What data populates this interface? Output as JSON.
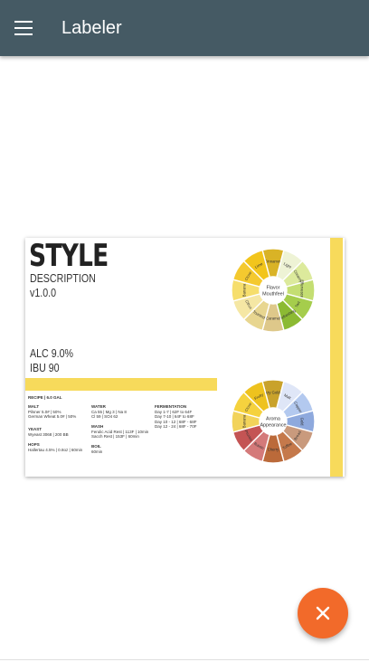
{
  "app": {
    "title": "Labeler"
  },
  "label": {
    "style": "STYLE",
    "description": "DESCRIPTION",
    "version": "v1.0.0",
    "abv": "ALC 9.0%",
    "ibu": "IBU 90",
    "recipe": {
      "heading": "RECIPE | 6.0 GAL",
      "malt_heading": "MALT",
      "malt": [
        "Pilsner 5.0# | 50%",
        "German Wheat 5.0# | 50%"
      ],
      "yeast_heading": "YEAST",
      "yeast": [
        "Wyeast 3068 | 200 BB"
      ],
      "hops_heading": "HOPS",
      "hops": [
        "Hallertau 4.5% | 0.8oz | 60min"
      ],
      "water_heading": "WATER",
      "water": [
        "Ca 55 | Mg 3 | Na 8",
        "Cl 59 | SO4 62"
      ],
      "mash_heading": "MASH",
      "mash": [
        "Ferulic Acid Rest | 113F | 10min",
        "Sacch Rest | 153F | 60min"
      ],
      "boil_heading": "BOIL",
      "boil": [
        "60min"
      ],
      "fermentation_heading": "FERMENTATION",
      "fermentation": [
        "Day 1-7 | 62F to 64F",
        "Day 7-10 | 64F to 68F",
        "Day 10 - 12 | 68F - 68F",
        "Day 12 - 24 | 68F - 70F"
      ]
    },
    "flavor_wheel": {
      "center": [
        "Flavor",
        "Mouthfeel"
      ],
      "segments": [
        {
          "label": "Cinnamon",
          "color": "#d9b326"
        },
        {
          "label": "Light",
          "color": "#eef3d5"
        },
        {
          "label": "Creamy",
          "color": "#dcea9c"
        },
        {
          "label": "Effervescent",
          "color": "#c4de72"
        },
        {
          "label": "Tart",
          "color": "#a5cd4c"
        },
        {
          "label": "Refreshing",
          "color": "#8cba33"
        },
        {
          "label": "Caramel",
          "color": "#dec88a"
        },
        {
          "label": "Toasted",
          "color": "#e8d690"
        },
        {
          "label": "Citrus",
          "color": "#f5e7a4"
        },
        {
          "label": "Banana",
          "color": "#f6de6c"
        },
        {
          "label": "Clove",
          "color": "#f4c92f"
        },
        {
          "label": "Lime",
          "color": "#f2c51c"
        }
      ]
    },
    "aroma_wheel": {
      "center": [
        "Aroma",
        "Appearance"
      ],
      "segments": [
        {
          "label": "Hazy Golden",
          "color": "#c9a22b"
        },
        {
          "label": "Malt",
          "color": "#dfe6f7"
        },
        {
          "label": "Copper",
          "color": "#b3c9ef"
        },
        {
          "label": "Gold",
          "color": "#8ea9dd"
        },
        {
          "label": "Bread",
          "color": "#c99a7d"
        },
        {
          "label": "Toffee",
          "color": "#c5794b"
        },
        {
          "label": "Cherry",
          "color": "#bb6a3a"
        },
        {
          "label": "Raisin",
          "color": "#d47a7a"
        },
        {
          "label": "Prunes",
          "color": "#c45454"
        },
        {
          "label": "Banana",
          "color": "#f2d35a"
        },
        {
          "label": "Clove",
          "color": "#f5d23e"
        },
        {
          "label": "Fruity",
          "color": "#eec21e"
        }
      ]
    }
  },
  "fab": {
    "icon": "close-icon",
    "color": "#f26a2a"
  }
}
